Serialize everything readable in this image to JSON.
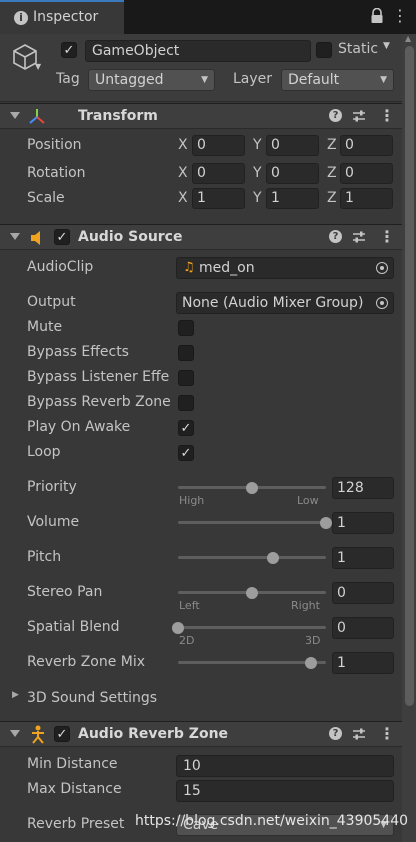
{
  "window": {
    "tab_title": "Inspector",
    "tab_icon": "info-icon",
    "menu_glyph": "⋮"
  },
  "gameobject": {
    "name": "GameObject",
    "active": true,
    "static_label": "Static",
    "static_checked": false,
    "tag_label": "Tag",
    "tag_value": "Untagged",
    "layer_label": "Layer",
    "layer_value": "Default"
  },
  "transform": {
    "title": "Transform",
    "rows": [
      {
        "label": "Position",
        "x": "0",
        "y": "0",
        "z": "0"
      },
      {
        "label": "Rotation",
        "x": "0",
        "y": "0",
        "z": "0"
      },
      {
        "label": "Scale",
        "x": "1",
        "y": "1",
        "z": "1"
      }
    ],
    "axis_x": "X",
    "axis_y": "Y",
    "axis_z": "Z"
  },
  "audio_source": {
    "title": "Audio Source",
    "enabled": true,
    "audio_clip_label": "AudioClip",
    "audio_clip_value": "med_on",
    "output_label": "Output",
    "output_value": "None (Audio Mixer Group)",
    "toggles": [
      {
        "label": "Mute",
        "checked": false
      },
      {
        "label": "Bypass Effects",
        "checked": false
      },
      {
        "label": "Bypass Listener Effe",
        "checked": false
      },
      {
        "label": "Bypass Reverb Zone",
        "checked": false
      },
      {
        "label": "Play On Awake",
        "checked": true
      },
      {
        "label": "Loop",
        "checked": true
      }
    ],
    "priority": {
      "label": "Priority",
      "value": "128",
      "level": 0.5,
      "min_caption": "High",
      "max_caption": "Low"
    },
    "volume": {
      "label": "Volume",
      "value": "1",
      "level": 1.0
    },
    "pitch": {
      "label": "Pitch",
      "value": "1",
      "level": 0.64
    },
    "stereo_pan": {
      "label": "Stereo Pan",
      "value": "0",
      "level": 0.5,
      "min_caption": "Left",
      "max_caption": "Right"
    },
    "spatial_blend": {
      "label": "Spatial Blend",
      "value": "0",
      "level": 0.0,
      "min_caption": "2D",
      "max_caption": "3D"
    },
    "reverb_zone_mix": {
      "label": "Reverb Zone Mix",
      "value": "1",
      "level": 0.9
    },
    "sound_3d_label": "3D Sound Settings"
  },
  "audio_reverb_zone": {
    "title": "Audio Reverb Zone",
    "enabled": true,
    "min_distance_label": "Min Distance",
    "min_distance_value": "10",
    "max_distance_label": "Max Distance",
    "max_distance_value": "15",
    "reverb_preset_label": "Reverb Preset",
    "reverb_preset_value": "Cave"
  },
  "watermark": "https://blog.csdn.net/weixin_43905440",
  "colors": {
    "background": "#383838",
    "header": "#3e3e3e",
    "field": "#2a2a2a",
    "text": "#c4c4c4",
    "accent_tab": "#3a79bb",
    "audio_icon": "#f0a31e"
  }
}
